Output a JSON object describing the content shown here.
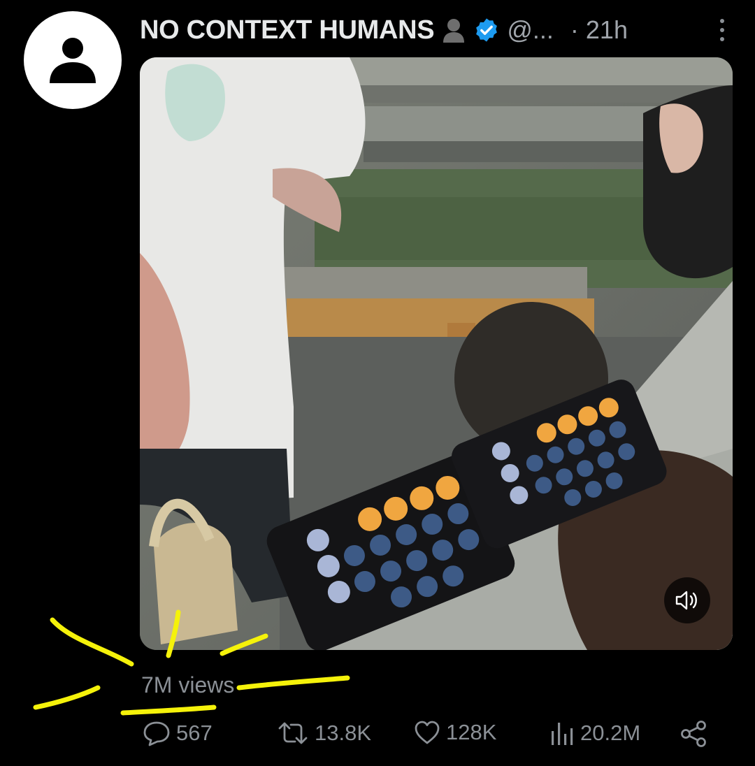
{
  "author": {
    "name": "NO CONTEXT HUMANS",
    "handle": "@...",
    "time_separator": "·",
    "time": "21h",
    "avatar_icon": "default-avatar-icon",
    "badge_emoji_icon": "bust-silhouette-icon",
    "verified_icon": "verified-badge-icon"
  },
  "media": {
    "type": "video",
    "sound_icon": "speaker-muted-icon"
  },
  "views": "7M views",
  "actions": {
    "replies": "567",
    "reposts": "13.8K",
    "likes": "128K",
    "analytics": "20.2M",
    "share_icon": "share-icon"
  },
  "annotation": {
    "color": "#f5f20a",
    "description_icon": "highlight-scribble"
  },
  "colors": {
    "background": "#000000",
    "verified": "#1d9bf0",
    "muted_text": "#8b9096"
  }
}
